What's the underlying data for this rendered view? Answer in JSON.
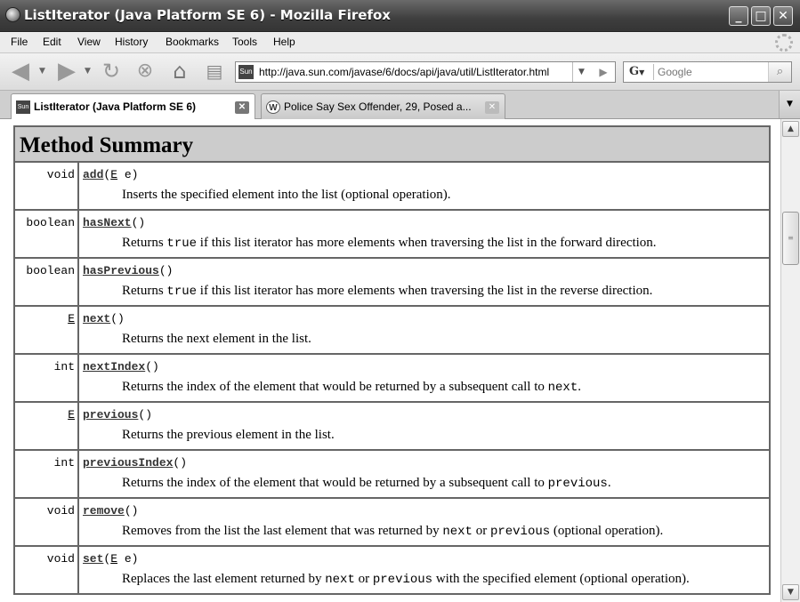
{
  "window": {
    "title": "ListIterator (Java Platform SE 6) - Mozilla Firefox",
    "minimize": "_",
    "maximize": "□",
    "close": "✕"
  },
  "menu": [
    {
      "label": "File"
    },
    {
      "label": "Edit"
    },
    {
      "label": "View"
    },
    {
      "label": "History"
    },
    {
      "label": "Bookmarks"
    },
    {
      "label": "Tools"
    },
    {
      "label": "Help"
    }
  ],
  "navbar": {
    "url": "http://java.sun.com/javase/6/docs/api/java/util/ListIterator.html",
    "site_icon_text": "Sun",
    "search_engine": "G",
    "search_placeholder": "Google"
  },
  "tabs": [
    {
      "label": "ListIterator (Java Platform SE 6)",
      "icon": "Sun",
      "active": true
    },
    {
      "label": "Police Say Sex Offender, 29, Posed a...",
      "icon": "W",
      "active": false
    }
  ],
  "page": {
    "heading": "Method Summary",
    "methods": [
      {
        "type": "void",
        "type_is_link": false,
        "name": "add",
        "sig_open": "(",
        "param_type": "E",
        "param_rest": " e)",
        "desc": [
          {
            "t": "Inserts the specified element into the list (optional operation)."
          }
        ]
      },
      {
        "type": "boolean",
        "type_is_link": false,
        "name": "hasNext",
        "sig_open": "()",
        "param_type": "",
        "param_rest": "",
        "desc": [
          {
            "t": "Returns "
          },
          {
            "c": "true"
          },
          {
            "t": " if this list iterator has more elements when traversing the list in the forward direction."
          }
        ]
      },
      {
        "type": "boolean",
        "type_is_link": false,
        "name": "hasPrevious",
        "sig_open": "()",
        "param_type": "",
        "param_rest": "",
        "desc": [
          {
            "t": "Returns "
          },
          {
            "c": "true"
          },
          {
            "t": " if this list iterator has more elements when traversing the list in the reverse direction."
          }
        ]
      },
      {
        "type": "E",
        "type_is_link": true,
        "name": "next",
        "sig_open": "()",
        "param_type": "",
        "param_rest": "",
        "desc": [
          {
            "t": "Returns the next element in the list."
          }
        ]
      },
      {
        "type": "int",
        "type_is_link": false,
        "name": "nextIndex",
        "sig_open": "()",
        "param_type": "",
        "param_rest": "",
        "desc": [
          {
            "t": "Returns the index of the element that would be returned by a subsequent call to "
          },
          {
            "c": "next"
          },
          {
            "t": "."
          }
        ]
      },
      {
        "type": "E",
        "type_is_link": true,
        "name": "previous",
        "sig_open": "()",
        "param_type": "",
        "param_rest": "",
        "desc": [
          {
            "t": "Returns the previous element in the list."
          }
        ]
      },
      {
        "type": "int",
        "type_is_link": false,
        "name": "previousIndex",
        "sig_open": "()",
        "param_type": "",
        "param_rest": "",
        "desc": [
          {
            "t": "Returns the index of the element that would be returned by a subsequent call to "
          },
          {
            "c": "previous"
          },
          {
            "t": "."
          }
        ]
      },
      {
        "type": "void",
        "type_is_link": false,
        "name": "remove",
        "sig_open": "()",
        "param_type": "",
        "param_rest": "",
        "desc": [
          {
            "t": "Removes from the list the last element that was returned by "
          },
          {
            "c": "next"
          },
          {
            "t": " or "
          },
          {
            "c": "previous"
          },
          {
            "t": " (optional operation)."
          }
        ]
      },
      {
        "type": "void",
        "type_is_link": false,
        "name": "set",
        "sig_open": "(",
        "param_type": "E",
        "param_rest": " e)",
        "desc": [
          {
            "t": "Replaces the last element returned by "
          },
          {
            "c": "next"
          },
          {
            "t": " or "
          },
          {
            "c": "previous"
          },
          {
            "t": " with the specified element (optional operation)."
          }
        ]
      }
    ]
  },
  "icons": {
    "back": "back-arrow-icon",
    "forward": "forward-arrow-icon",
    "reload": "reload-icon",
    "stop": "stop-icon",
    "home": "home-icon",
    "bookmark": "bookmark-add-icon",
    "search": "magnifier-icon"
  }
}
